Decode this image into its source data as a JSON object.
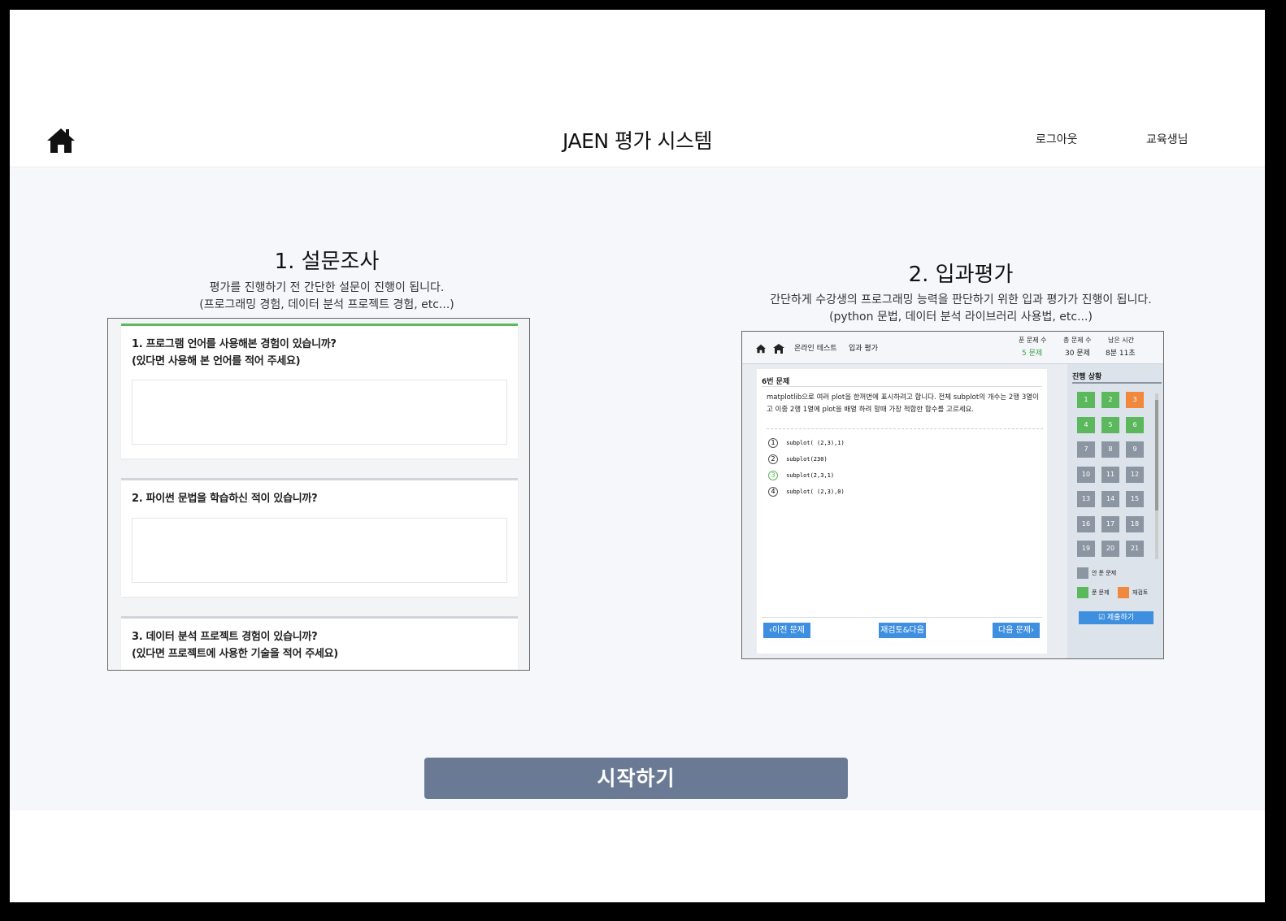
{
  "header": {
    "title": "JAEN 평가 시스템",
    "logout_label": "로그아웃",
    "user_label": "교육생님"
  },
  "survey": {
    "title": "1. 설문조사",
    "desc_line1": "평가를 진행하기 전 간단한 설문이 진행이 됩니다.",
    "desc_line2": "(프로그래밍 경험, 데이터 분석 프로젝트 경험, etc...)",
    "questions": [
      {
        "line1": "1. 프로그램 언어를 사용해본 경험이 있습니까?",
        "line2": "(있다면 사용해 본 언어를 적어 주세요)"
      },
      {
        "line1": "2. 파이썬 문법을 학습하신 적이 있습니까?",
        "line2": ""
      },
      {
        "line1": "3. 데이터 분석 프로젝트 경험이 있습니까?",
        "line2": "(있다면 프로젝트에 사용한 기술을 적어 주세요)"
      }
    ]
  },
  "placement": {
    "title": "2. 입과평가",
    "desc_line1": "간단하게 수강생의 프로그래밍 능력을 판단하기 위한 입과 평가가 진행이 됩니다.",
    "desc_line2": "(python 문법, 데이터 분석 라이브러리 사용법, etc...)",
    "preview": {
      "breadcrumb_a": "온라인 테스트",
      "breadcrumb_b": "입과 평가",
      "stat1_label": "푼 문제 수",
      "stat1_value": "5 문제",
      "stat2_label": "총 문제 수",
      "stat2_value": "30 문제",
      "stat3_label": "남은 시간",
      "stat3_value": "8분 11초",
      "q_number": "6번 문제",
      "q_text": "matplotlib으로 여러 plot을 한꺼번에 표시하려고 합니다. 전체 subplot의 개수는 2행 3열이고 이중 2행 1열에 plot을 배열 하려 할때 가장 적합한 함수를 고르세요.",
      "options": [
        {
          "num": "1",
          "code": "subplot( (2,3),1)"
        },
        {
          "num": "2",
          "code": "subplot(230)"
        },
        {
          "num": "3",
          "code": "subplot(2,3,1)"
        },
        {
          "num": "4",
          "code": "subplot( (2,3),0)"
        }
      ],
      "prev_label": "이전 문제",
      "review_label": "재검토&다음",
      "next_label": "다음 문제",
      "progress_label": "진행 상황",
      "grid": [
        "1",
        "2",
        "3",
        "4",
        "5",
        "6",
        "7",
        "8",
        "9",
        "10",
        "11",
        "12",
        "13",
        "14",
        "15",
        "16",
        "17",
        "18",
        "19",
        "20",
        "21"
      ],
      "legend_unsolved": "안 푼 문제",
      "legend_solved": "푼 문제",
      "legend_review": "재검토",
      "submit_label": "제출하기",
      "colors": {
        "solved": "#5cb85c",
        "review": "#f0883e",
        "unsolved": "#8c96a3",
        "accent": "#3f8fe0"
      }
    }
  },
  "start_label": "시작하기"
}
